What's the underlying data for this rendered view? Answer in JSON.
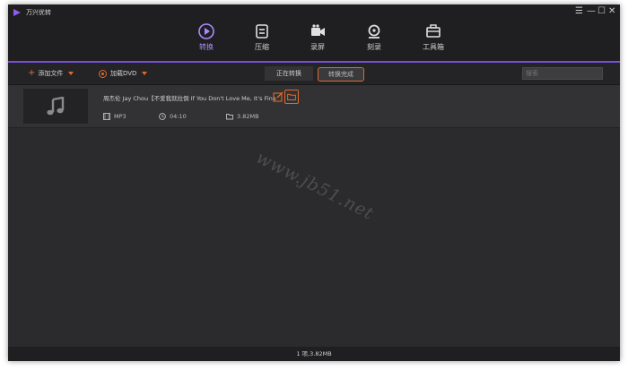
{
  "app": {
    "title": "万兴优转"
  },
  "window_controls": [
    "☰",
    "—",
    "☐",
    "✕"
  ],
  "nav": {
    "items": [
      {
        "label": "转换",
        "icon": "convert-icon",
        "active": true
      },
      {
        "label": "压缩",
        "icon": "compress-icon",
        "active": false
      },
      {
        "label": "录屏",
        "icon": "record-icon",
        "active": false
      },
      {
        "label": "刻录",
        "icon": "burn-icon",
        "active": false
      },
      {
        "label": "工具箱",
        "icon": "toolbox-icon",
        "active": false
      }
    ]
  },
  "toolbar": {
    "add_file": "添加文件",
    "load_dvd": "加载DVD",
    "tab_converting": "正在转换",
    "tab_converted": "转换完成",
    "search_placeholder": "搜索"
  },
  "files": [
    {
      "name": "周杰伦 Jay Chou【不爱我就拉倒 If You Don't Love Me, It's Fine",
      "format": "MP3",
      "duration": "04:10",
      "size": "3.82MB"
    }
  ],
  "status_bar": {
    "text": "1 项,3.82MB"
  },
  "watermark": "www.jb51.net",
  "colors": {
    "accent_purple": "#a98cff",
    "accent_orange": "#e06a2b",
    "bg_dark": "#2b2b2d"
  }
}
